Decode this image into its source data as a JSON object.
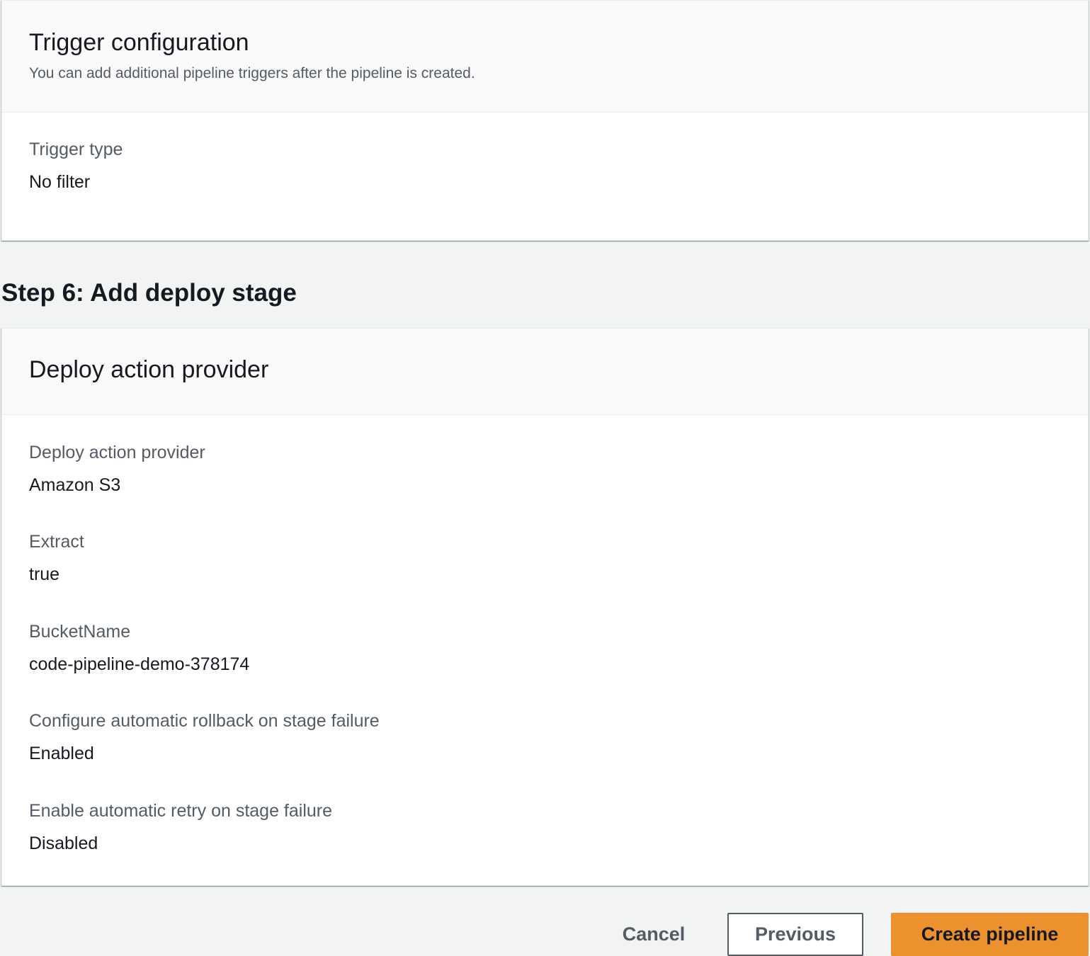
{
  "trigger_panel": {
    "title": "Trigger configuration",
    "description": "You can add additional pipeline triggers after the pipeline is created.",
    "fields": [
      {
        "label": "Trigger type",
        "value": "No filter"
      }
    ]
  },
  "step": {
    "heading": "Step 6: Add deploy stage"
  },
  "deploy_panel": {
    "title": "Deploy action provider",
    "fields": [
      {
        "label": "Deploy action provider",
        "value": "Amazon S3"
      },
      {
        "label": "Extract",
        "value": "true"
      },
      {
        "label": "BucketName",
        "value": "code-pipeline-demo-378174"
      },
      {
        "label": "Configure automatic rollback on stage failure",
        "value": "Enabled"
      },
      {
        "label": "Enable automatic retry on stage failure",
        "value": "Disabled"
      }
    ]
  },
  "actions": {
    "cancel_label": "Cancel",
    "previous_label": "Previous",
    "create_label": "Create pipeline"
  },
  "colors": {
    "page_background": "#f2f3f3",
    "primary_button": "#ec912d",
    "label_text": "#545b64",
    "value_text": "#16191f"
  }
}
